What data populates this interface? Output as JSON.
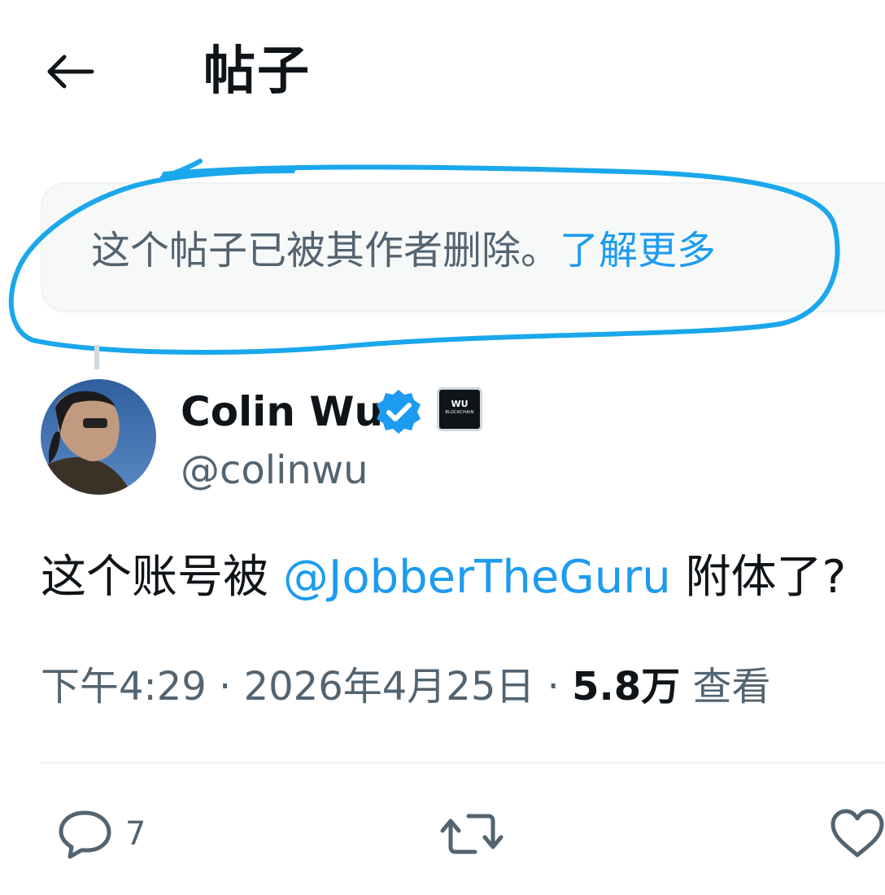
{
  "header": {
    "title": "帖子",
    "back_icon": "arrow-left-icon"
  },
  "notice": {
    "text": "这个帖子已被其作者删除。",
    "link": "了解更多"
  },
  "author": {
    "name": "Colin Wu",
    "handle": "@colinwu",
    "verified": true,
    "badge_line1": "WU",
    "badge_line2": "BLOCKCHAIN"
  },
  "post": {
    "text_before": "这个账号被 ",
    "mention": "@JobberTheGuru",
    "text_after": " 附体了?"
  },
  "meta": {
    "time": "下午4:29",
    "separator": " · ",
    "date": "2026年4月25日",
    "views_count": "5.8万",
    "views_label": " 查看"
  },
  "actions": {
    "replies_count": "7",
    "reply_icon": "comment-icon",
    "repost_icon": "repost-icon",
    "like_icon": "heart-icon"
  },
  "colors": {
    "accent": "#1d9bf0",
    "secondary_text": "#536471",
    "primary_text": "#0f1419",
    "annotation": "#1aa7ec"
  }
}
